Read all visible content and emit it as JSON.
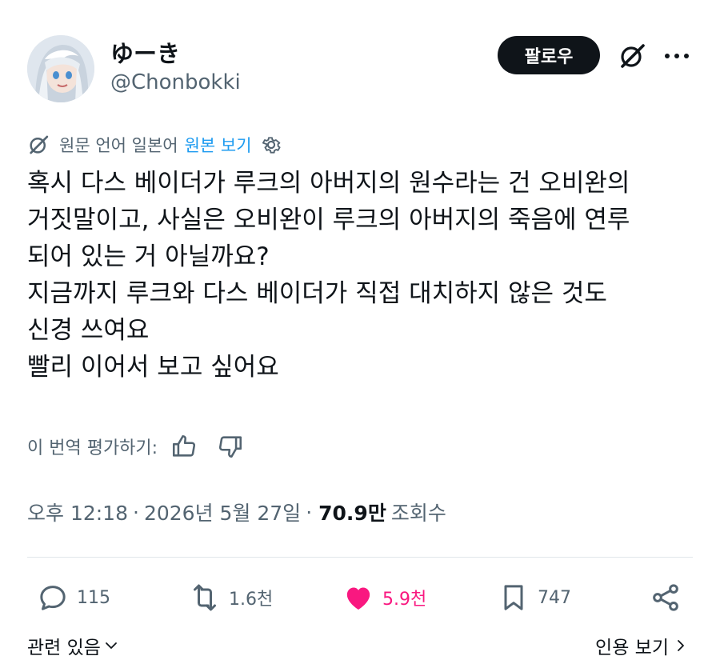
{
  "user": {
    "display_name": "ゆーき",
    "handle": "@Chonbokki"
  },
  "header": {
    "follow_label": "팔로우"
  },
  "translation": {
    "source_text": "원문 언어 일본어",
    "show_original_label": "원본 보기"
  },
  "tweet": {
    "lines": [
      "혹시 다스 베이더가 루크의 아버지의 원수라는 건 오비완의",
      "거짓말이고, 사실은 오비완이 루크의 아버지의 죽음에 연루",
      "되어 있는 거 아닐까요?",
      "지금까지 루크와 다스 베이더가 직접 대치하지 않은 것도",
      "신경 쓰여요",
      "빨리 이어서 보고 싶어요"
    ]
  },
  "rating": {
    "label": "이 번역 평가하기:"
  },
  "meta": {
    "time": "오후 12:18",
    "separator": "·",
    "date": "2026년 5월 27일",
    "views": "70.9만",
    "views_label": "조회수"
  },
  "actions": {
    "replies": "115",
    "retweets": "1.6천",
    "likes": "5.9천",
    "bookmarks": "747"
  },
  "footer": {
    "related_label": "관련 있음",
    "quotes_label": "인용 보기"
  },
  "colors": {
    "accent": "#1d9bf0",
    "like": "#f91880",
    "muted": "#536471",
    "text": "#0f1419"
  }
}
